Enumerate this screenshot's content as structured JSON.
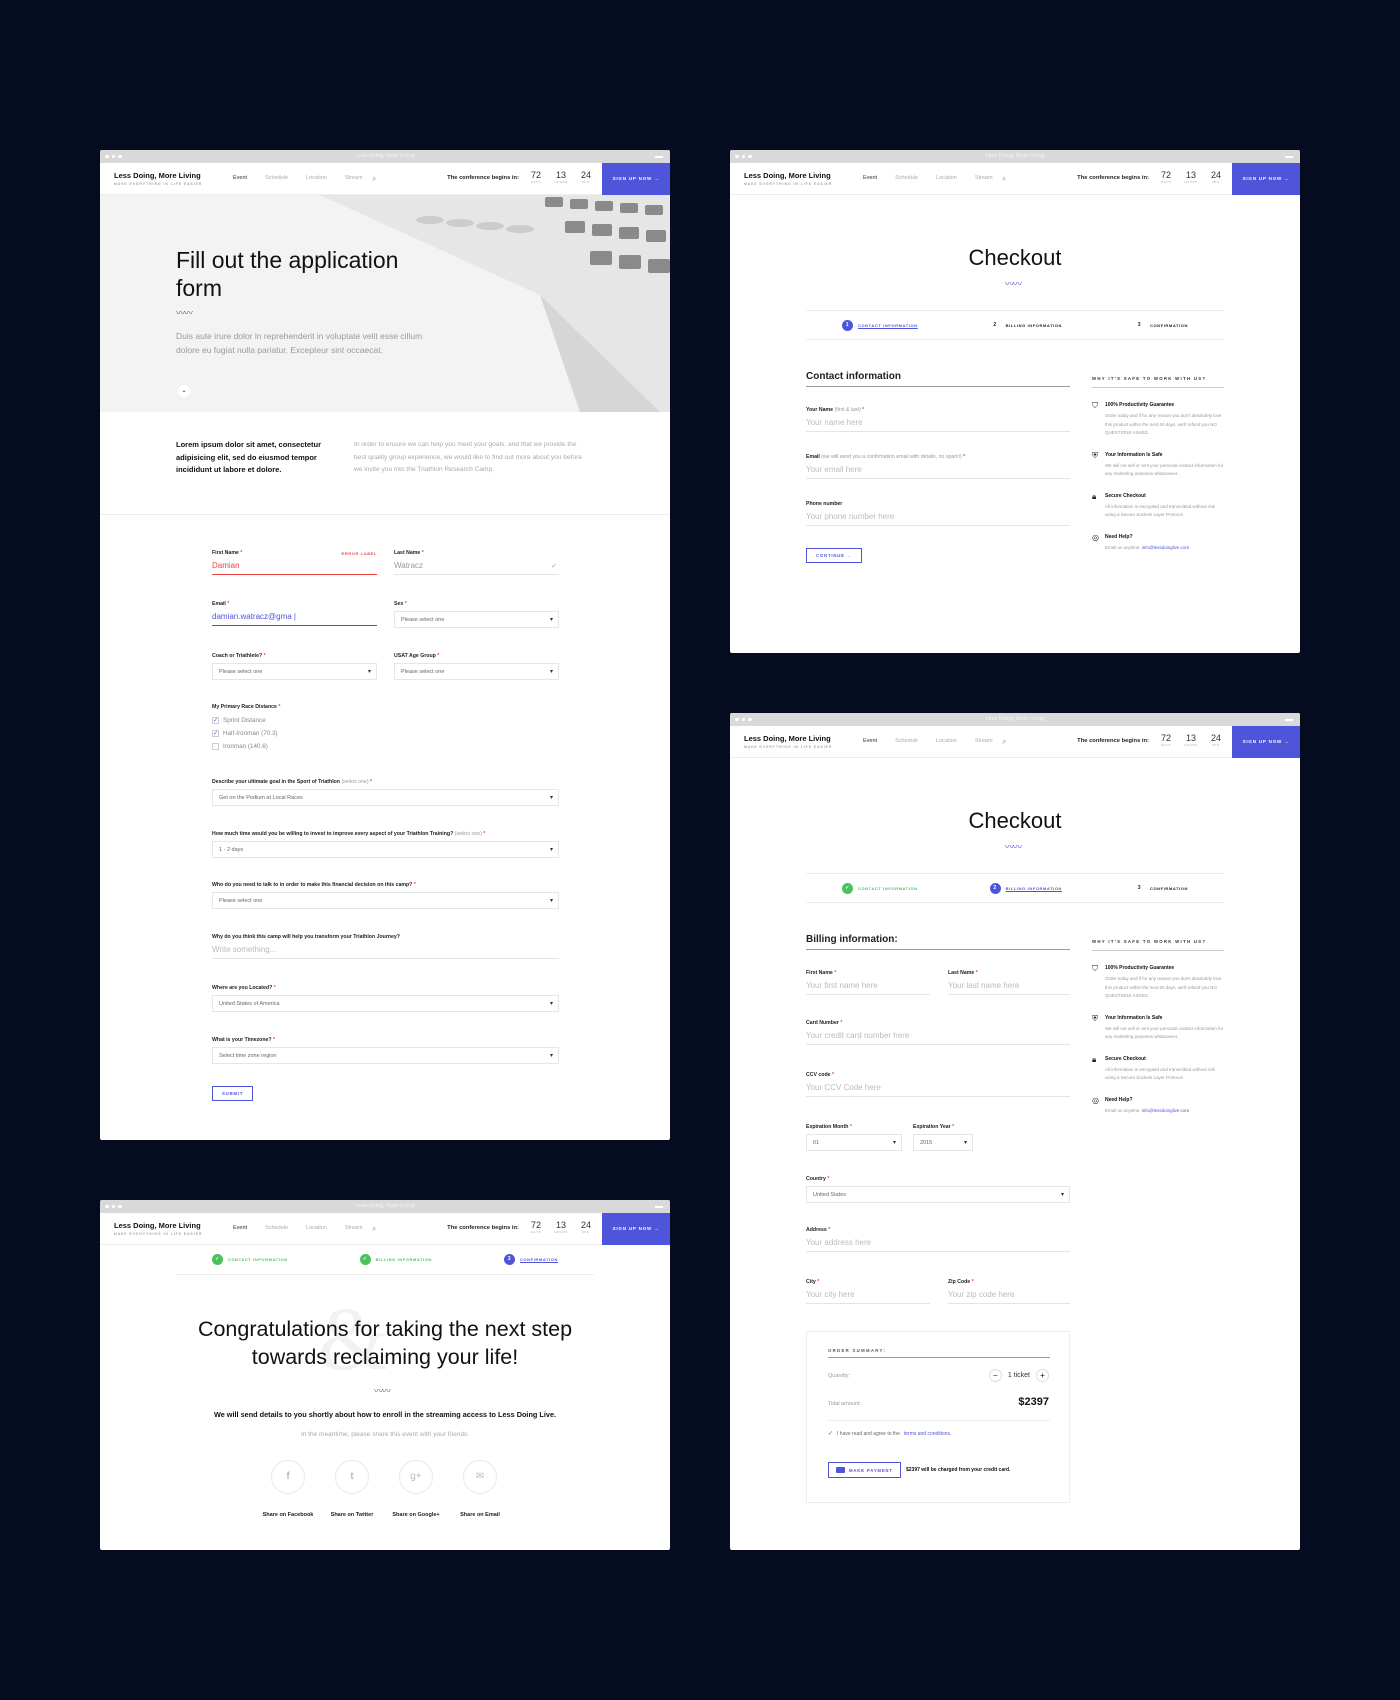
{
  "header": {
    "window_title": "Less Doing, More Living",
    "brand": "Less Doing, More Living",
    "tagline": "MAKE EVERYTHING IN LIFE EASIER",
    "nav": [
      "Event",
      "Schedule",
      "Location",
      "Stream"
    ],
    "countdown_label": "The conference begins in:",
    "countdown": [
      {
        "value": "72",
        "unit": "DAYS"
      },
      {
        "value": "13",
        "unit": "HOURS"
      },
      {
        "value": "24",
        "unit": "MIN"
      }
    ],
    "signup": "SIGN UP NOW →"
  },
  "application": {
    "title": "Fill out the application form",
    "intro": "Duis aute irure dolor in reprehenderit in voluptate velit esse cillum dolore eu fugiat nulla pariatur. Excepteur sint occaecat.",
    "lead": "Lorem ipsum dolor sit amet, consectetur adipisicing elit, sed do eiusmod tempor incididunt ut labore et dolore.",
    "lead_body": "In order to ensure we can help you meet your goals, and that we provide the best quality group experience, we would like to find out more about you before we invite you into the Triathlon Research Camp.",
    "first_name_label": "First Name",
    "error_label": "ERROR LABEL",
    "first_name_value": "Damian",
    "last_name_label": "Last Name",
    "last_name_value": "Watracz",
    "email_label": "Email",
    "email_value": "damian.watracz@gma |",
    "sex_label": "Sex",
    "sex_value": "Please select one",
    "coach_label": "Coach or Triathlete?",
    "coach_value": "Please select one",
    "age_label": "USAT Age Group",
    "age_value": "Please select one",
    "race_label": "My Primary Race Distance",
    "race_options": [
      {
        "label": "Sprint Distance",
        "checked": true
      },
      {
        "label": "Half-Ironman (70.3)",
        "checked": true
      },
      {
        "label": "Ironman (140.6)",
        "checked": false
      }
    ],
    "goal_label": "Describe your ultimate goal in the Sport of Triathlon",
    "goal_hint": "(select one)",
    "goal_value": "Get on the Podium at Local Races",
    "time_label": "How much time would you be willing to invest to improve every aspect of your Triathlon Training?",
    "time_hint": "(select one)",
    "time_value": "1 - 2 days",
    "talk_label": "Who do you need to talk to in order to make this financial decision on this camp?",
    "talk_value": "Please select one",
    "why_label": "Why do you think this camp will help you transform your Triathlon Journey?",
    "why_placeholder": "Write something...",
    "loc_label": "Where are you Located?",
    "loc_value": "United States of America",
    "tz_label": "What is your Timezone?",
    "tz_value": "Select time zone region",
    "submit": "SUBMIT"
  },
  "steps": {
    "contact": "CONTACT INFORMATION",
    "billing": "BILLING INFORMATION",
    "confirmation": "CONFIRMATION"
  },
  "checkout1": {
    "title": "Checkout",
    "section": "Contact information",
    "name_label": "Your Name",
    "name_hint": "(first & last)",
    "name_ph": "Your name here",
    "email_label": "Email",
    "email_hint": "(we will send you a confirmation email with details, no spam!)",
    "email_ph": "Your email here",
    "phone_label": "Phone number",
    "phone_ph": "Your phone number here",
    "continue": "CONTINUE →"
  },
  "safe": {
    "heading": "WHY IT'S SAFE TO WORK WITH US?",
    "items": [
      {
        "icon": "badge-icon",
        "title": "100% Productivity Guarantee",
        "text": "Order today and if for any reason you don't absolutely love this product within the next 60 days, we'll refund you NO QUESTIONS ASKED."
      },
      {
        "icon": "shield-icon",
        "title": "Your Information Is Safe",
        "text": "We will not sell or rent your personal contact information for any marketing purposes whatsoever."
      },
      {
        "icon": "lock-icon",
        "title": "Secure Checkout",
        "text": "All information is encrypted and transmitted without risk using a Secure Sockets Layer Protocol."
      },
      {
        "icon": "lifebuoy-icon",
        "title": "Need Help?",
        "text": "Email us anytime:",
        "link": "info@lessdoinglive.com"
      }
    ]
  },
  "checkout2": {
    "title": "Checkout",
    "section": "Billing information:",
    "first_label": "First Name",
    "first_ph": "Your first name here",
    "last_label": "Last Name",
    "last_ph": "Your last name here",
    "card_label": "Card Number",
    "card_ph": "Your credit card number here",
    "ccv_label": "CCV code",
    "ccv_ph": "Your CCV Code here",
    "month_label": "Expiration Month",
    "month_value": "01",
    "year_label": "Expiration Year",
    "year_value": "2015",
    "country_label": "Country",
    "country_value": "United States",
    "address_label": "Address",
    "address_ph": "Your address here",
    "city_label": "City",
    "city_ph": "Your city here",
    "zip_label": "Zip Code",
    "zip_ph": "Your zip code here",
    "summary_title": "ORDER SUMMARY:",
    "qty_label": "Quantity:",
    "minus": "−",
    "qty_value": "1 ticket",
    "plus": "+",
    "total_label": "Total amount:",
    "total_value": "$2397",
    "agree_text": "I have read and agree to the",
    "agree_link": "terms and conditions.",
    "pay_button": "MAKE PAYMENT",
    "pay_note": "$2397 will be charged from your credit card."
  },
  "confirm": {
    "title": "Congratulations for taking the next step towards reclaiming your life!",
    "subtitle": "We will send details to you shortly about how to enroll in the streaming access to Less Doing Live.",
    "share_hint": "In the meantime, please share this event with your friends:",
    "shares": [
      {
        "icon": "facebook-icon",
        "glyph": "f",
        "label": "Share on Facebook"
      },
      {
        "icon": "twitter-icon",
        "glyph": "t",
        "label": "Share on Twitter"
      },
      {
        "icon": "googleplus-icon",
        "glyph": "g+",
        "label": "Share on Google+"
      },
      {
        "icon": "email-icon",
        "glyph": "✉",
        "label": "Share on Email"
      }
    ]
  },
  "colors": {
    "accent": "#4f55db",
    "success": "#4ac25a",
    "error": "#e44",
    "background": "#050c1f"
  }
}
